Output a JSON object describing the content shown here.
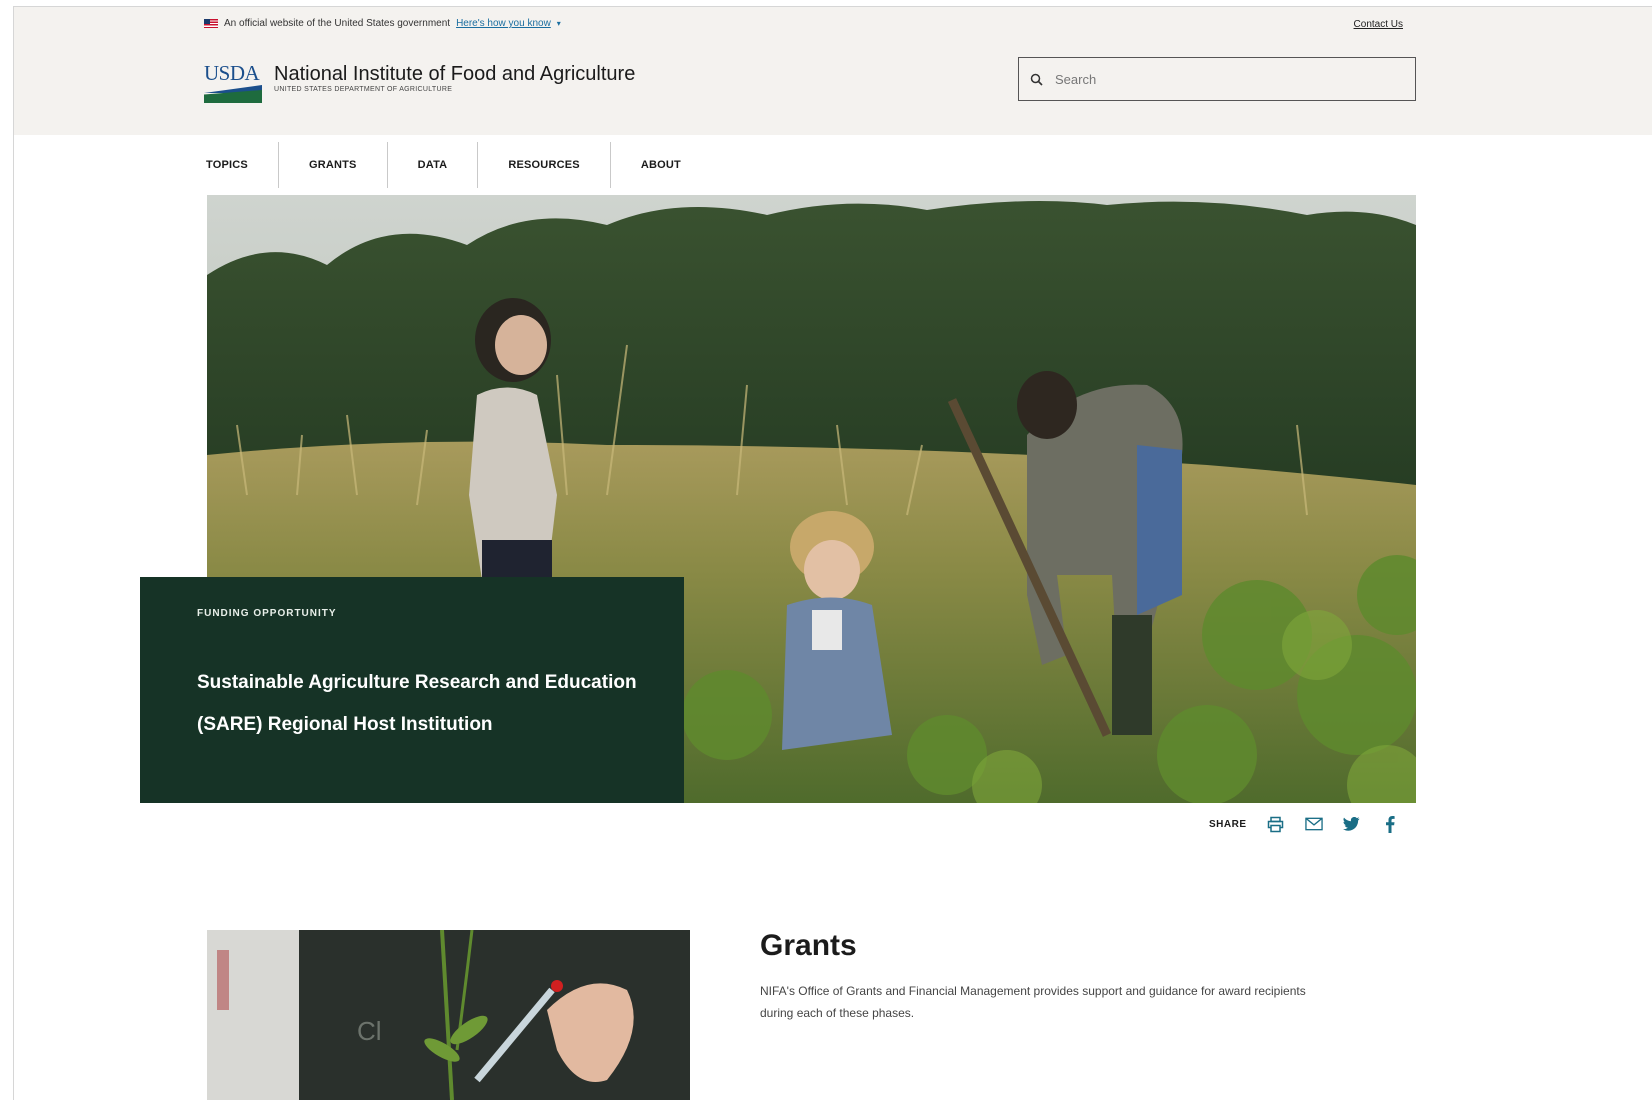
{
  "gov_banner": {
    "official_text": "An official website of the United States government",
    "how_link": "Here's how you know"
  },
  "header": {
    "contact_link": "Contact Us",
    "logo_text": "USDA",
    "agency_name": "National Institute of Food and Agriculture",
    "agency_sub": "UNITED STATES DEPARTMENT OF AGRICULTURE",
    "search_placeholder": "Search"
  },
  "nav": {
    "items": [
      {
        "label": "TOPICS"
      },
      {
        "label": "GRANTS"
      },
      {
        "label": "DATA"
      },
      {
        "label": "RESOURCES"
      },
      {
        "label": "ABOUT"
      }
    ]
  },
  "feature": {
    "eyebrow": "FUNDING OPPORTUNITY",
    "headline": "Sustainable Agriculture Research and Education (SARE) Regional Host Institution"
  },
  "share": {
    "label": "SHARE",
    "icons": [
      "print-icon",
      "email-icon",
      "twitter-icon",
      "facebook-icon"
    ]
  },
  "grants": {
    "title": "Grants",
    "description": "NIFA's Office of Grants and Financial Management provides support and guidance for award recipients during each of these phases."
  },
  "colors": {
    "header_bg": "#f4f2ef",
    "feature_bg": "#163326",
    "share_icon": "#1a6e86",
    "link": "#1a6ea0"
  }
}
